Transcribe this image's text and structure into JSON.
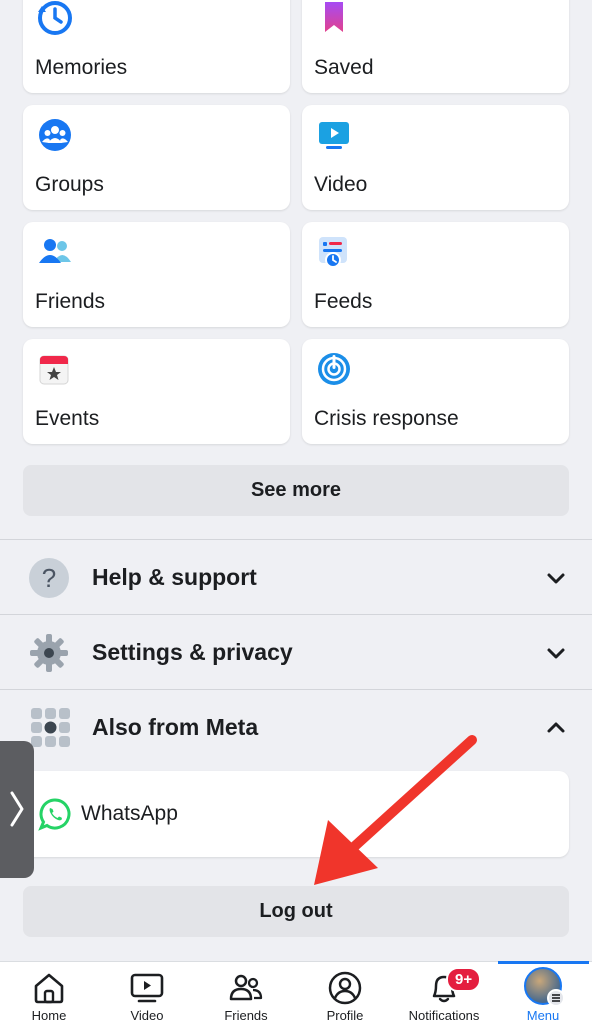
{
  "shortcuts": [
    {
      "label": "Memories",
      "icon": "memories-icon"
    },
    {
      "label": "Saved",
      "icon": "saved-icon"
    },
    {
      "label": "Groups",
      "icon": "groups-icon"
    },
    {
      "label": "Video",
      "icon": "video-icon"
    },
    {
      "label": "Friends",
      "icon": "friends-icon"
    },
    {
      "label": "Feeds",
      "icon": "feeds-icon"
    },
    {
      "label": "Events",
      "icon": "events-icon"
    },
    {
      "label": "Crisis response",
      "icon": "crisis-response-icon"
    }
  ],
  "see_more": "See more",
  "sections": {
    "help": {
      "label": "Help & support",
      "icon": "help-icon",
      "expanded": false
    },
    "settings": {
      "label": "Settings & privacy",
      "icon": "gear-icon",
      "expanded": false
    },
    "meta": {
      "label": "Also from Meta",
      "icon": "apps-grid-icon",
      "expanded": true
    }
  },
  "meta_apps": [
    {
      "label": "WhatsApp",
      "icon": "whatsapp-icon"
    }
  ],
  "logout": "Log out",
  "tabbar": {
    "tabs": [
      {
        "label": "Home",
        "icon": "home-icon"
      },
      {
        "label": "Video",
        "icon": "video-play-icon"
      },
      {
        "label": "Friends",
        "icon": "friends-tab-icon"
      },
      {
        "label": "Profile",
        "icon": "profile-icon"
      },
      {
        "label": "Notifications",
        "icon": "bell-icon",
        "badge": "9+"
      },
      {
        "label": "Menu",
        "icon": "avatar",
        "active": true
      }
    ]
  },
  "colors": {
    "accent": "#1877f2",
    "badge": "#e41e3f",
    "annotation_arrow": "#f0352b"
  }
}
